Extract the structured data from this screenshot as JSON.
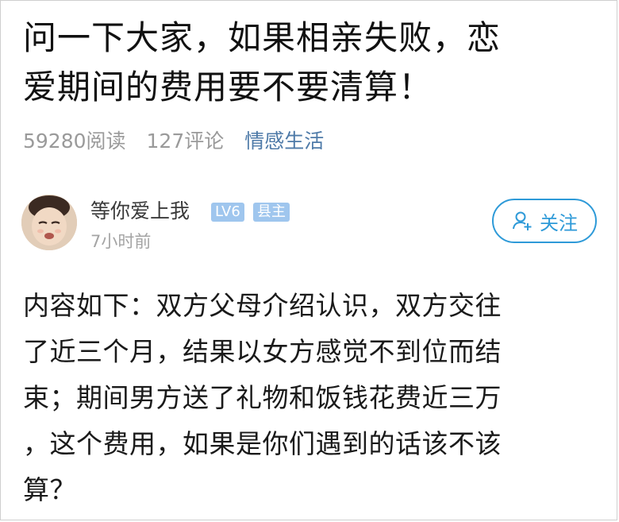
{
  "post": {
    "title_lines": [
      "问一下大家，如果相亲失败，恋",
      "爱期间的费用要不要清算！"
    ],
    "read_count": "59280阅读",
    "comment_count": "127评论",
    "category": "情感生活"
  },
  "author": {
    "name": "等你爱上我",
    "level": "LV6",
    "role": "县主",
    "time": "7小时前"
  },
  "follow": {
    "label": "关注",
    "color": "#2e9ad8"
  },
  "content": {
    "lines": [
      "内容如下：双方父母介绍认识，双方交往",
      "了近三个月，结果以女方感觉不到位而结",
      "束；期间男方送了礼物和饭钱花费近三万",
      "，这个费用，如果是你们遇到的话该不该",
      "算？"
    ]
  },
  "colors": {
    "meta_gray": "#9a9a9a",
    "category_blue": "#4e7aa8",
    "badge_blue": "#9fc6ee"
  }
}
